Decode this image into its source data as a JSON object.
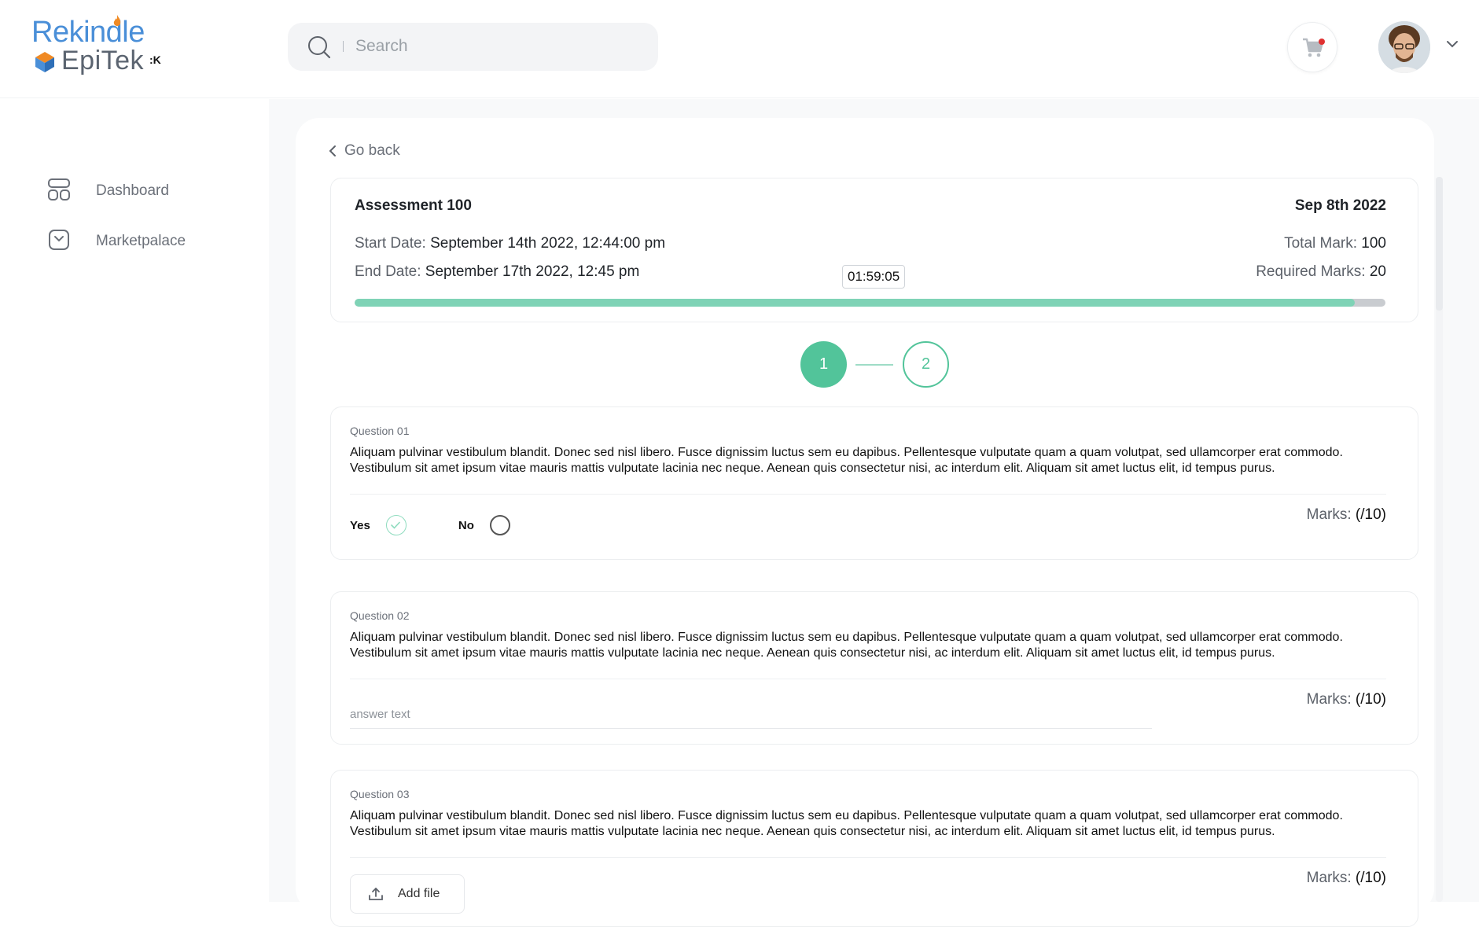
{
  "brand": {
    "line1": "Rekindle",
    "line2": "EpiTek",
    "mark": ":K"
  },
  "search": {
    "placeholder": "Search"
  },
  "header": {
    "cart_icon": "cart-icon",
    "user_avatar": "avatar"
  },
  "sidebar": {
    "items": [
      {
        "label": "Dashboard",
        "icon": "dashboard-icon"
      },
      {
        "label": "Marketpalace",
        "icon": "marketplace-icon"
      }
    ]
  },
  "main": {
    "go_back": "Go back",
    "assessment": {
      "title": "Assessment 100",
      "date": "Sep 8th 2022",
      "start_label": "Start Date: ",
      "start_value": "September 14th 2022, 12:44:00 pm",
      "end_label": "End Date: ",
      "end_value": "September 17th 2022, 12:45 pm",
      "total_label": "Total Mark: ",
      "total_value": "100",
      "required_label": "Required Marks: ",
      "required_value": "20",
      "timer": "01:59:05",
      "progress_fraction": 0.97
    },
    "steps": [
      "1",
      "2"
    ],
    "questions": [
      {
        "label": "Question 01",
        "text": "Aliquam pulvinar vestibulum blandit. Donec sed nisl libero. Fusce dignissim luctus sem eu dapibus. Pellentesque vulputate quam a quam volutpat, sed ullamcorper erat commodo. Vestibulum sit amet ipsum vitae mauris mattis vulputate lacinia nec neque. Aenean quis consectetur nisi, ac interdum elit. Aliquam sit amet luctus elit, id tempus purus.",
        "yes_label": "Yes",
        "no_label": "No",
        "marks_label": "Marks: ",
        "marks_value": "(/10)"
      },
      {
        "label": "Question 02",
        "text": "Aliquam pulvinar vestibulum blandit. Donec sed nisl libero. Fusce dignissim luctus sem eu dapibus. Pellentesque vulputate quam a quam volutpat, sed ullamcorper erat commodo. Vestibulum sit amet ipsum vitae mauris mattis vulputate lacinia nec neque. Aenean quis consectetur nisi, ac interdum elit. Aliquam sit amet luctus elit, id tempus purus.",
        "answer_placeholder": "answer text",
        "marks_label": "Marks: ",
        "marks_value": "(/10)"
      },
      {
        "label": "Question 03",
        "text": "Aliquam pulvinar vestibulum blandit. Donec sed nisl libero. Fusce dignissim luctus sem eu dapibus. Pellentesque vulputate quam a quam volutpat, sed ullamcorper erat commodo. Vestibulum sit amet ipsum vitae mauris mattis vulputate lacinia nec neque. Aenean quis consectetur nisi, ac interdum elit. Aliquam sit amet luctus elit, id tempus purus.",
        "add_file_label": "Add file",
        "marks_label": "Marks: ",
        "marks_value": "(/10)"
      }
    ]
  },
  "colors": {
    "accent": "#52c49a",
    "progress": "#7fd3b6",
    "brand_blue": "#4a8fd8",
    "brand_orange": "#f08a24"
  }
}
